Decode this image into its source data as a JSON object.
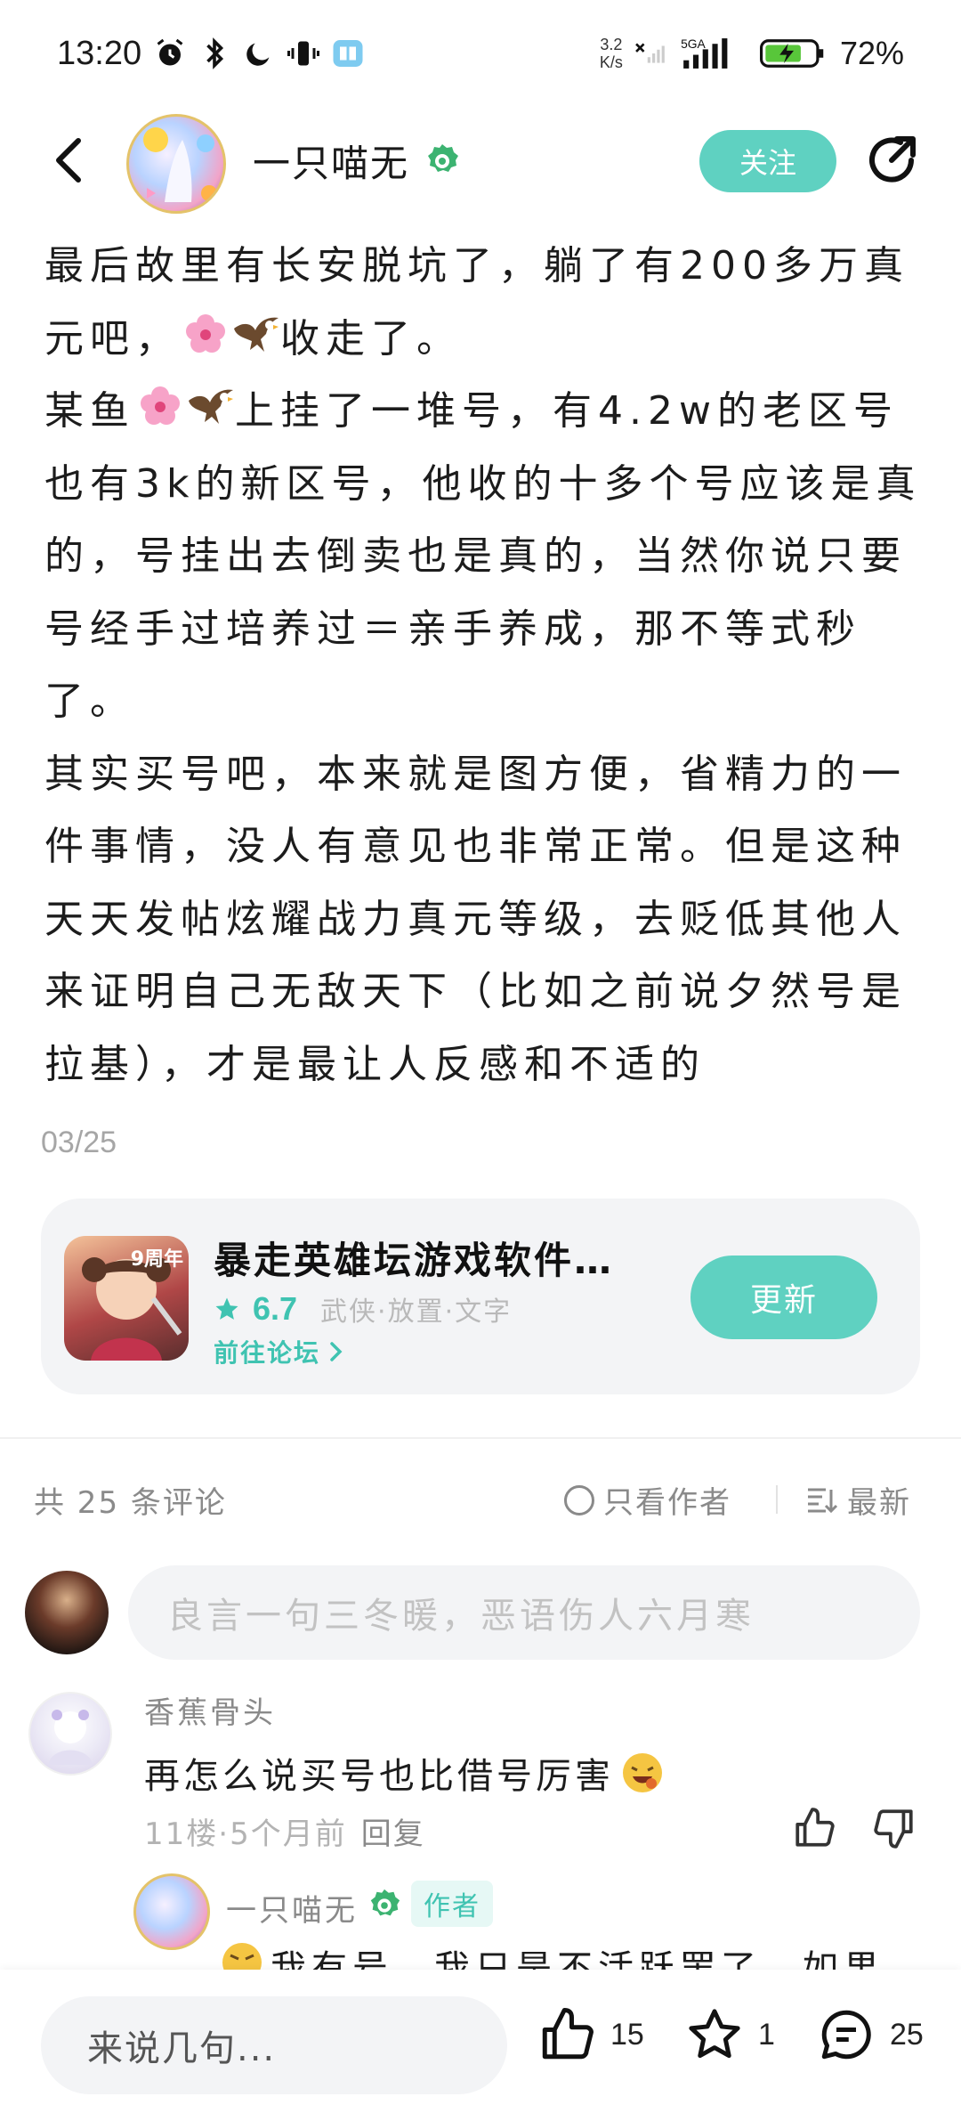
{
  "status_bar": {
    "time": "13:20",
    "net_speed_value": "3.2",
    "net_speed_unit": "K/s",
    "network_label": "5GA",
    "battery_percent": "72%",
    "icons": [
      "alarm-icon",
      "bluetooth-icon",
      "moon-icon",
      "vibrate-icon",
      "book-icon",
      "wifi-off-icon",
      "signal-icon",
      "battery-charging-icon"
    ]
  },
  "header": {
    "author_name": "一只喵无",
    "follow_label": "关注"
  },
  "post": {
    "paragraphs": [
      {
        "before": "最后故里有长安脱坑了，躺了有200多万真元吧，",
        "after": "收走了。"
      },
      {
        "before": "某鱼",
        "after": "上挂了一堆号，有4.2w的老区号也有3k的新区号，他收的十多个号应该是真的，号挂出去倒卖也是真的，当然你说只要号经手过培养过＝亲手养成，那不等式秒了。"
      },
      {
        "before": "其实买号吧，本来就是图方便，省精力的一件事情，没人有意见也非常正常。但是这种天天发帖炫耀战力真元等级，去贬低其他人来证明自己无敌天下（比如之前说夕然号是拉基），才是最让人反感和不适的",
        "after": ""
      }
    ],
    "date": "03/25"
  },
  "game_card": {
    "icon_text": "9周年",
    "title": "暴走英雄坛游戏软件…",
    "rating": "6.7",
    "tags": "武侠·放置·文字",
    "link_label": "前往论坛",
    "update_label": "更新"
  },
  "comments_header": {
    "count_label": "共 25 条评论",
    "only_author_label": "只看作者",
    "sort_label": "最新"
  },
  "comment_input": {
    "placeholder": "良言一句三冬暖，恶语伤人六月寒"
  },
  "comment": {
    "username": "香蕉骨头",
    "text": "再怎么说买号也比借号厉害",
    "meta": "11楼·5个月前",
    "reply_label": "回复"
  },
  "reply": {
    "username": "一只喵无",
    "author_tag": "作者",
    "text_partial": "我有号，我只是不活跃罢了，如果"
  },
  "bottom_bar": {
    "input_placeholder": "来说几句...",
    "likes": "15",
    "favorites": "1",
    "comments": "25"
  },
  "colors": {
    "accent": "#5fd1c1",
    "accent_text": "#3fc3b1",
    "muted": "#8a8a8a",
    "surface": "#f3f4f6"
  }
}
